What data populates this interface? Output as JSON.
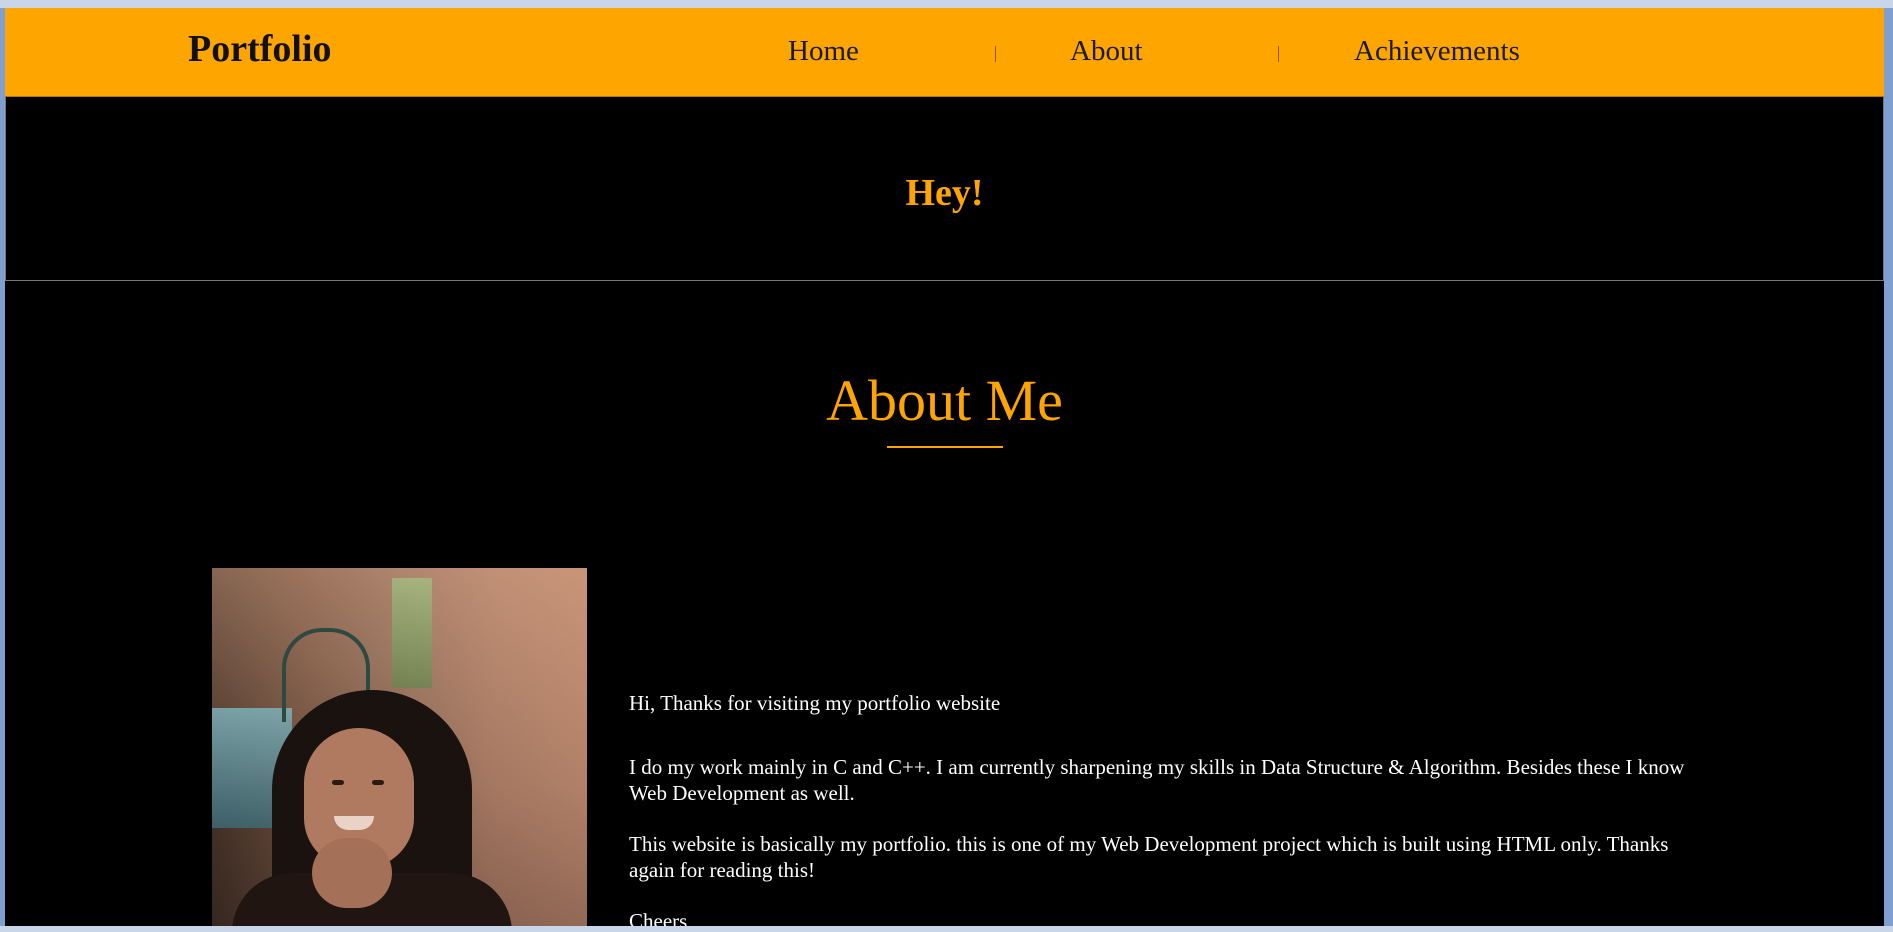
{
  "nav": {
    "brand": "Portfolio",
    "links": [
      "Home",
      "About",
      "Achievements"
    ]
  },
  "hero": {
    "greeting": "Hey!"
  },
  "about": {
    "title": "About Me",
    "paragraphs": [
      "Hi, Thanks for visiting my portfolio website",
      "I do my work mainly in C and C++. I am currently sharpening my skills in Data Structure & Algorithm. Besides these I know Web Development as well.",
      "This website is basically my portfolio. this is one of my Web Development project which is built using HTML only. Thanks again for reading this!",
      "Cheers,"
    ]
  },
  "colors": {
    "accent": "#ffa500",
    "background": "#000000",
    "text": "#ffffff"
  }
}
